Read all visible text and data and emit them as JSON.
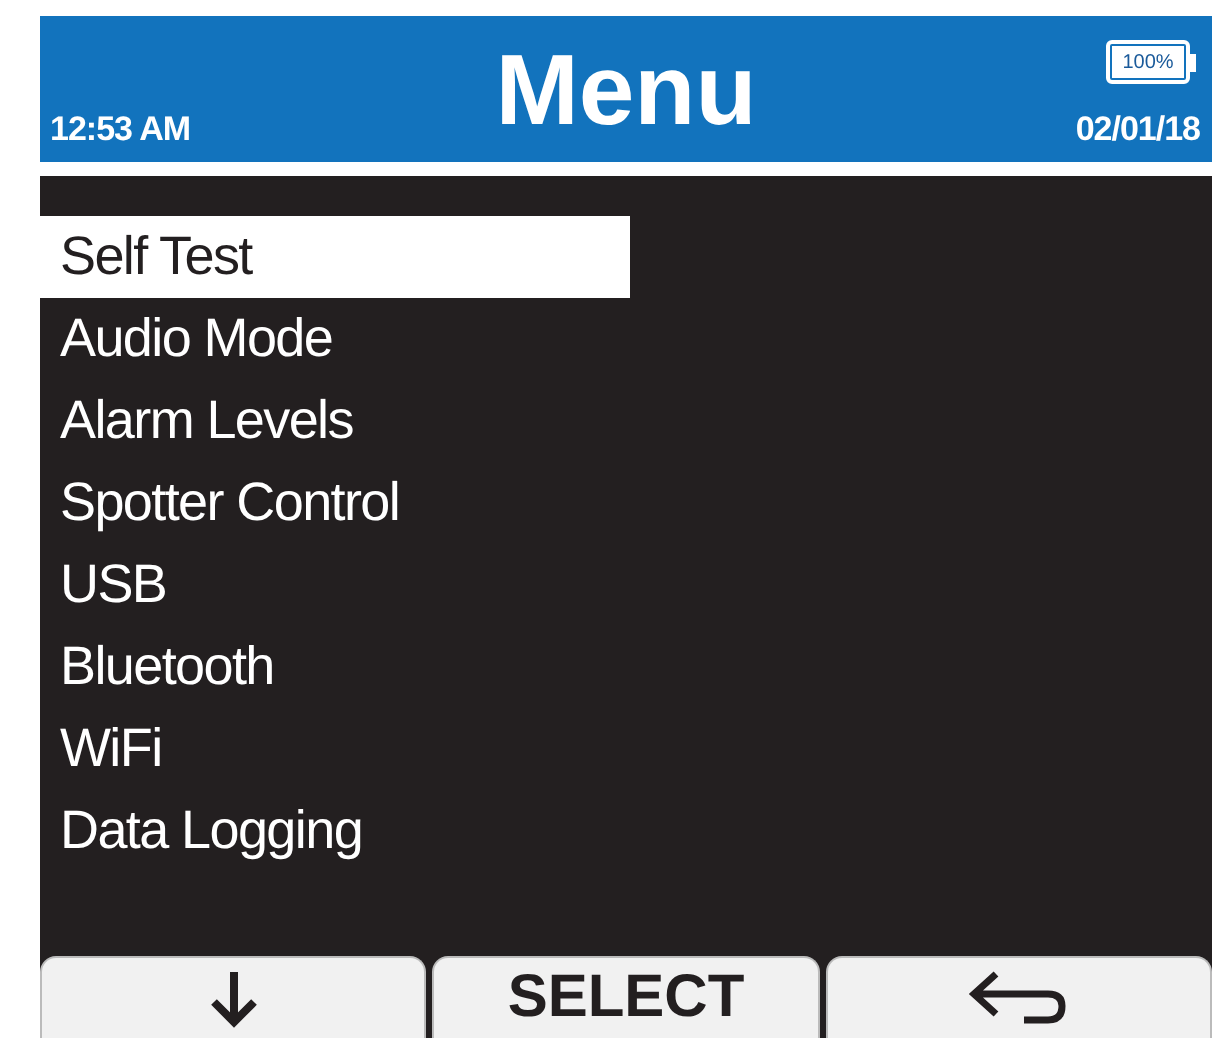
{
  "header": {
    "title": "Menu",
    "time": "12:53 AM",
    "date": "02/01/18",
    "battery": {
      "label": "100%",
      "level": 1
    }
  },
  "menu_items": [
    {
      "label": "Self Test",
      "selected": true
    },
    {
      "label": "Audio Mode",
      "selected": false
    },
    {
      "label": "Alarm Levels",
      "selected": false
    },
    {
      "label": "Spotter Control",
      "selected": false
    },
    {
      "label": "USB",
      "selected": false
    },
    {
      "label": "Bluetooth",
      "selected": false
    },
    {
      "label": "WiFi",
      "selected": false
    },
    {
      "label": "Data Logging",
      "selected": false
    }
  ],
  "softkeys": [
    {
      "kind": "down"
    },
    {
      "kind": "text",
      "label": "SELECT"
    },
    {
      "kind": "back"
    }
  ]
}
